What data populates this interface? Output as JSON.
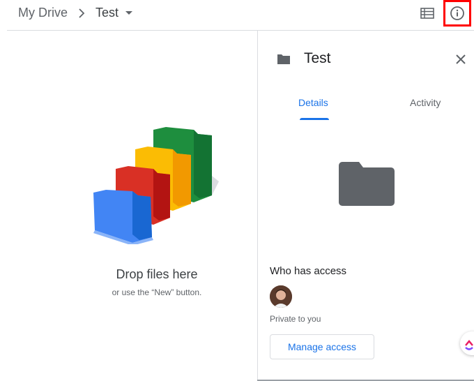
{
  "breadcrumb": {
    "root": "My Drive",
    "separator": ">",
    "current": "Test"
  },
  "header": {
    "list_view_icon": "list-view-icon",
    "info_icon": "info-icon"
  },
  "drop_zone": {
    "title": "Drop files here",
    "subtitle": "or use the “New” button."
  },
  "details_panel": {
    "title": "Test",
    "tabs": [
      {
        "label": "Details",
        "active": true
      },
      {
        "label": "Activity",
        "active": false
      }
    ],
    "who_has_access": "Who has access",
    "private_text": "Private to you",
    "manage_access_label": "Manage access"
  },
  "colors": {
    "accent": "#1a73e8",
    "highlight_border": "#ff0000",
    "folder": "#5f6368"
  }
}
